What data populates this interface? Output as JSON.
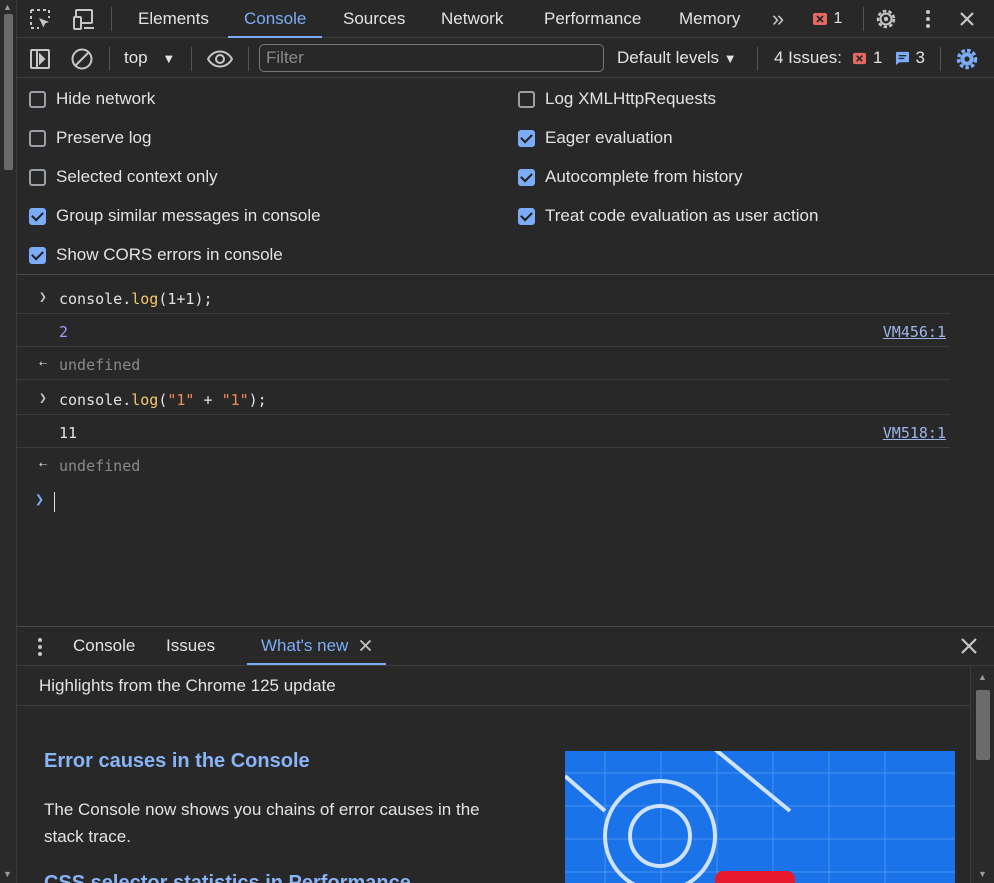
{
  "tabs": {
    "elements": "Elements",
    "console": "Console",
    "sources": "Sources",
    "network": "Network",
    "performance": "Performance",
    "memory": "Memory",
    "error_count": "1"
  },
  "toolbar": {
    "context": "top",
    "filter_placeholder": "Filter",
    "levels": "Default levels",
    "issues_label": "4 Issues:",
    "issues_errors": "1",
    "issues_info": "3"
  },
  "settings": {
    "left": [
      {
        "label": "Hide network",
        "checked": false
      },
      {
        "label": "Preserve log",
        "checked": false
      },
      {
        "label": "Selected context only",
        "checked": false
      },
      {
        "label": "Group similar messages in console",
        "checked": true
      },
      {
        "label": "Show CORS errors in console",
        "checked": true
      }
    ],
    "right": [
      {
        "label": "Log XMLHttpRequests",
        "checked": false
      },
      {
        "label": "Eager evaluation",
        "checked": true
      },
      {
        "label": "Autocomplete from history",
        "checked": true
      },
      {
        "label": "Treat code evaluation as user action",
        "checked": true
      }
    ]
  },
  "console": {
    "entries": [
      {
        "kind": "input",
        "tokens": [
          [
            "plain",
            "console."
          ],
          [
            "fn",
            "log"
          ],
          [
            "plain",
            "(1+1);"
          ]
        ]
      },
      {
        "kind": "output",
        "text": "2",
        "style": "num",
        "source": "VM456:1"
      },
      {
        "kind": "result",
        "text": "undefined"
      },
      {
        "kind": "input",
        "tokens": [
          [
            "plain",
            "console."
          ],
          [
            "fn",
            "log"
          ],
          [
            "plain",
            "("
          ],
          [
            "str",
            "\"1\""
          ],
          [
            "plain",
            " + "
          ],
          [
            "str",
            "\"1\""
          ],
          [
            "plain",
            ");"
          ]
        ]
      },
      {
        "kind": "output",
        "text": "11",
        "style": "plain",
        "source": "VM518:1"
      },
      {
        "kind": "result",
        "text": "undefined"
      }
    ]
  },
  "drawer": {
    "tabs": {
      "console": "Console",
      "issues": "Issues",
      "whats_new": "What's new"
    },
    "heading": "Highlights from the Chrome 125 update",
    "item_title": "Error causes in the Console",
    "item_desc": "The Console now shows you chains of error causes in the stack trace.",
    "item_title2": "CSS selector statistics in Performance"
  },
  "colors": {
    "accent": "#7cacf8",
    "error": "#e46962",
    "info": "#7cacf8",
    "image_bg": "#1a73e8"
  }
}
